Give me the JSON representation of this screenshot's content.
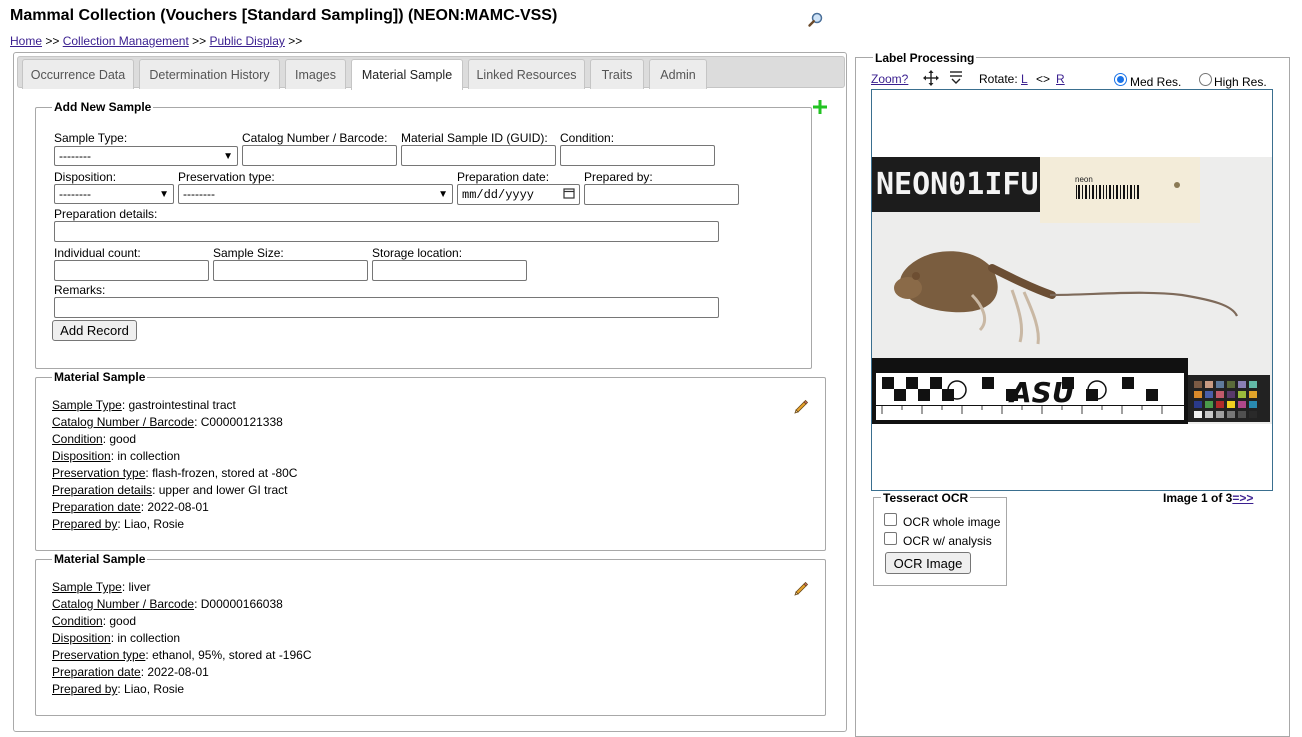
{
  "header": {
    "title": "Mammal Collection (Vouchers [Standard Sampling]) (NEON:MAMC-VSS)",
    "breadcrumb": {
      "home": "Home",
      "sep": ">>",
      "collection_management": "Collection Management",
      "public_display": "Public Display"
    }
  },
  "tabs": [
    {
      "label": "Occurrence Data"
    },
    {
      "label": "Determination History"
    },
    {
      "label": "Images"
    },
    {
      "label": "Material Sample",
      "active": true
    },
    {
      "label": "Linked Resources"
    },
    {
      "label": "Traits"
    },
    {
      "label": "Admin"
    }
  ],
  "add_sample": {
    "legend": "Add New Sample",
    "labels": {
      "sample_type": "Sample Type:",
      "catalog_number": "Catalog Number / Barcode:",
      "material_sample_id": "Material Sample ID (GUID):",
      "condition": "Condition:",
      "disposition": "Disposition:",
      "preservation_type": "Preservation type:",
      "preparation_date": "Preparation date:",
      "prepared_by": "Prepared by:",
      "preparation_details": "Preparation details:",
      "individual_count": "Individual count:",
      "sample_size": "Sample Size:",
      "storage_location": "Storage location:",
      "remarks": "Remarks:"
    },
    "select_placeholder": "--------",
    "date_placeholder": "mm/dd/yyyy",
    "add_button": "Add Record"
  },
  "samples": [
    {
      "legend": "Material Sample",
      "fields": [
        {
          "key": "Sample Type",
          "value": "gastrointestinal tract"
        },
        {
          "key": "Catalog Number / Barcode",
          "value": "C00000121338"
        },
        {
          "key": "Condition",
          "value": "good"
        },
        {
          "key": "Disposition",
          "value": "in collection"
        },
        {
          "key": "Preservation type",
          "value": "flash-frozen, stored at -80C"
        },
        {
          "key": "Preparation details",
          "value": "upper and lower GI tract"
        },
        {
          "key": "Preparation date",
          "value": "2022-08-01"
        },
        {
          "key": "Prepared by",
          "value": "Liao, Rosie"
        }
      ]
    },
    {
      "legend": "Material Sample",
      "fields": [
        {
          "key": "Sample Type",
          "value": "liver"
        },
        {
          "key": "Catalog Number / Barcode",
          "value": "D00000166038"
        },
        {
          "key": "Condition",
          "value": "good"
        },
        {
          "key": "Disposition",
          "value": "in collection"
        },
        {
          "key": "Preservation type",
          "value": "ethanol, 95%, stored at -196C"
        },
        {
          "key": "Preparation date",
          "value": "2022-08-01"
        },
        {
          "key": "Prepared by",
          "value": "Liao, Rosie"
        }
      ]
    }
  ],
  "label_processing": {
    "title": "Label Processing",
    "zoom": "Zoom?",
    "rotate": "Rotate:",
    "rotate_left": "L",
    "rotate_sep": "<>",
    "rotate_right": "R",
    "med_res": "Med Res.",
    "high_res": "High Res.",
    "resolution_selected": "Med Res.",
    "image_tag": "NEON01IFU",
    "label_brand": "neon",
    "ruler_brand": "ASU",
    "image_counter": "Image 1 of 3",
    "next_link": "=>>"
  },
  "ocr": {
    "legend": "Tesseract OCR",
    "whole_image": "OCR whole image",
    "with_analysis": "OCR w/ analysis",
    "button": "OCR Image"
  },
  "colors": {
    "add_icon": "#22c322",
    "link": "#3a1f8f",
    "image_border": "#3a6f8f"
  }
}
